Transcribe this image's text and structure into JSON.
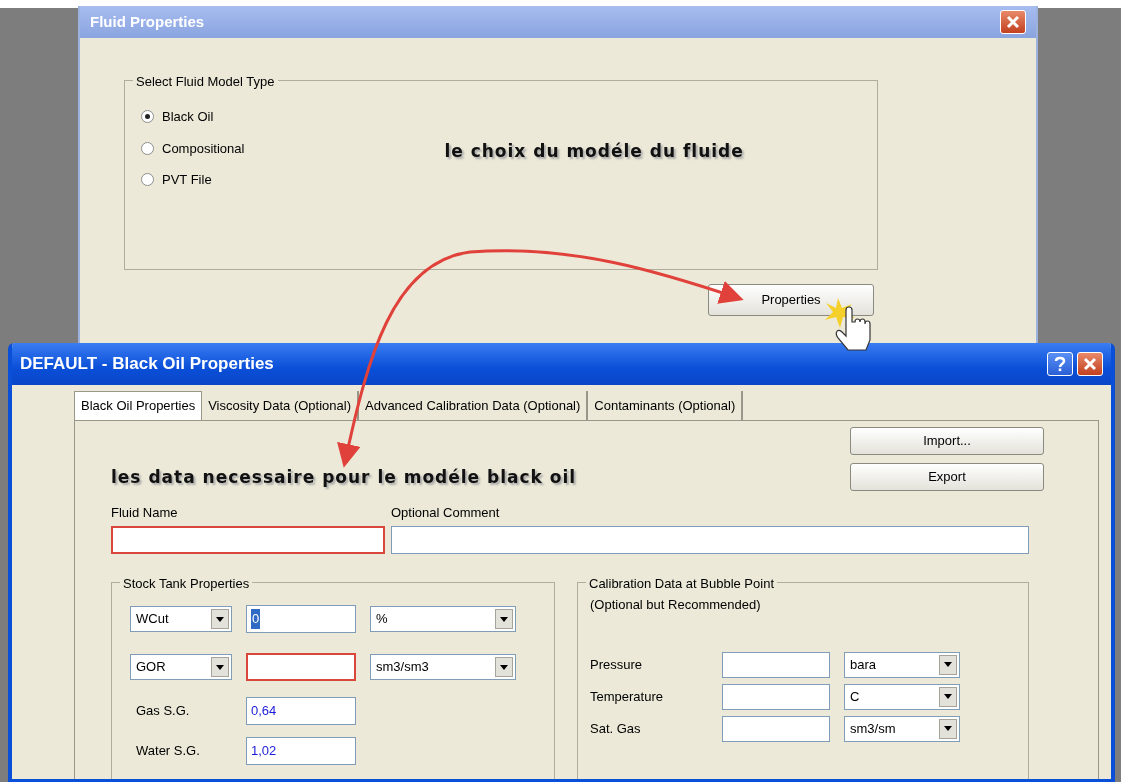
{
  "fluid_window": {
    "title": "Fluid Properties",
    "group_title": "Select Fluid Model Type",
    "options": [
      {
        "label": "Black Oil",
        "selected": true
      },
      {
        "label": "Compositional",
        "selected": false
      },
      {
        "label": "PVT File",
        "selected": false
      }
    ],
    "annotation": "le choix du modéle du fluide",
    "properties_button": "Properties"
  },
  "oil_window": {
    "title": "DEFAULT - Black Oil Properties",
    "tabs": [
      {
        "label": "Black Oil Properties",
        "selected": true
      },
      {
        "label": "Viscosity Data (Optional)",
        "selected": false
      },
      {
        "label": "Advanced Calibration Data (Optional)",
        "selected": false
      },
      {
        "label": "Contaminants (Optional)",
        "selected": false
      }
    ],
    "buttons": [
      "Import...",
      "Export"
    ],
    "annotation": "les data necessaire pour le modéle black oil",
    "fluid_name": {
      "label": "Fluid Name",
      "required": true
    },
    "comment": {
      "label": "Optional Comment"
    },
    "stock_tank": {
      "title": "Stock Tank Properties",
      "rows": [
        {
          "kind": "select",
          "selector": "WCut",
          "value": "0",
          "unit": "%",
          "required": false
        },
        {
          "kind": "select",
          "selector": "GOR",
          "unit": "sm3/sm3",
          "required": true
        },
        {
          "kind": "plain",
          "label": "Gas S.G.",
          "value": "0,64"
        },
        {
          "kind": "plain",
          "label": "Water S.G.",
          "value": "1,02"
        }
      ]
    },
    "calibration": {
      "title": "Calibration Data at Bubble Point",
      "note": "(Optional but Recommended)",
      "rows": [
        {
          "label": "Pressure",
          "unit": "bara"
        },
        {
          "label": "Temperature",
          "unit": "C"
        },
        {
          "label": "Sat. Gas",
          "unit": "sm3/sm"
        }
      ]
    }
  }
}
